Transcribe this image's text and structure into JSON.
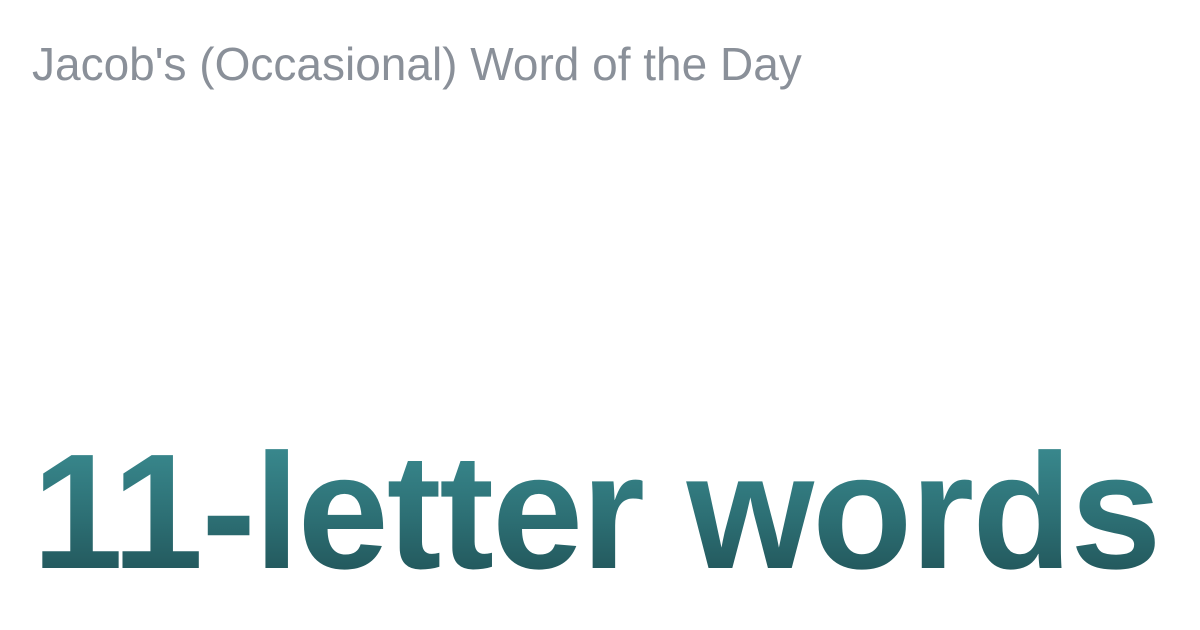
{
  "site": {
    "title": "Jacob's (Occasional) Word of the Day"
  },
  "post": {
    "headline": "11-letter words"
  },
  "colors": {
    "background": "#ffffff",
    "site_title": "#8a9099",
    "headline_top": "#3c8f94",
    "headline_bottom": "#1f4f53"
  }
}
